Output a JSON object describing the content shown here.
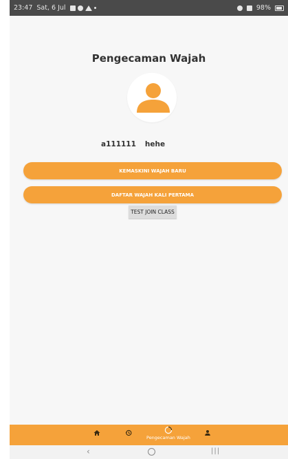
{
  "status_bar": {
    "time": "23:47",
    "date": "Sat, 6 Jul",
    "battery": "98%"
  },
  "page": {
    "title": "Pengecaman Wajah"
  },
  "user": {
    "id": "a111111",
    "name": "hehe"
  },
  "buttons": {
    "update_face": "KEMASKINI WAJAH BARU",
    "register_face": "DAFTAR WAJAH KALI PERTAMA",
    "test_join": "TEST JOIN CLASS"
  },
  "bottom_nav": {
    "items": [
      {
        "icon": "home-icon",
        "label": ""
      },
      {
        "icon": "history-icon",
        "label": ""
      },
      {
        "icon": "face-scan-icon",
        "label": "Pengecaman Wajah",
        "active": true
      },
      {
        "icon": "person-icon",
        "label": ""
      }
    ]
  },
  "colors": {
    "accent": "#f5a23a",
    "background": "#f7f7f7",
    "statusbar": "#4a4a4a"
  }
}
